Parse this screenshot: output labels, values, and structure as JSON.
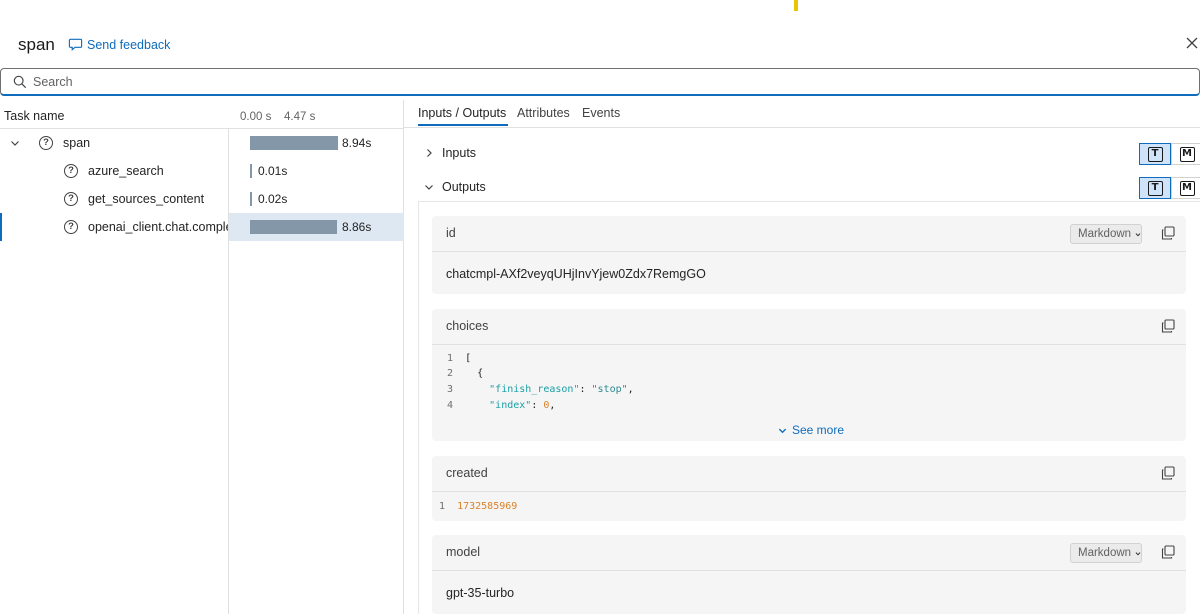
{
  "header": {
    "title": "span",
    "feedback_label": "Send feedback"
  },
  "search": {
    "placeholder": "Search"
  },
  "task_table": {
    "col_task": "Task name",
    "time_start": "0.00 s",
    "time_mid": "4.47 s",
    "rows": [
      {
        "name": "span",
        "duration": "8.94s",
        "duration_fraction": 1.0
      },
      {
        "name": "azure_search",
        "duration": "0.01s",
        "duration_fraction": 0.001
      },
      {
        "name": "get_sources_content",
        "duration": "0.02s",
        "duration_fraction": 0.002
      },
      {
        "name": "openai_client.chat.completions.create",
        "duration": "8.86s",
        "duration_fraction": 0.991
      }
    ]
  },
  "tabs": [
    "Inputs / Outputs",
    "Attributes",
    "Events"
  ],
  "sections": {
    "inputs_label": "Inputs",
    "outputs_label": "Outputs",
    "format_text_glyph": "T",
    "format_markdown_glyph": "M"
  },
  "cards": {
    "id": {
      "title": "id",
      "format": "Markdown",
      "value": "chatcmpl-AXf2veyqUHjInvYjew0Zdx7RemgGO"
    },
    "choices": {
      "title": "choices",
      "lines": [
        {
          "n": "1",
          "text": "["
        },
        {
          "n": "2",
          "text": "  {"
        },
        {
          "n": "3",
          "key": "\"finish_reason\"",
          "sep": ": ",
          "val": "\"stop\"",
          "end": ","
        },
        {
          "n": "4",
          "key": "\"index\"",
          "sep": ": ",
          "val": "0",
          "end": ","
        }
      ],
      "see_more": "See more"
    },
    "created": {
      "title": "created",
      "line_no": "1",
      "value": "1732585969"
    },
    "model": {
      "title": "model",
      "format": "Markdown",
      "value": "gpt-35-turbo"
    }
  },
  "colors": {
    "accent": "#0f6cbd",
    "bar": "#8497a8",
    "selected_row": "#dde8f2"
  }
}
